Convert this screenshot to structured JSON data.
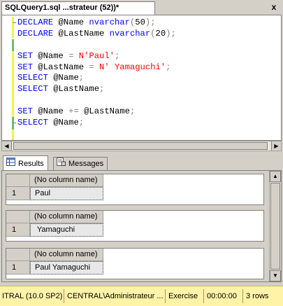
{
  "document_tab": {
    "title": "SQLQuery1.sql ...strateur (52))*",
    "close_label": "x"
  },
  "editor": {
    "lines": [
      {
        "tokens": [
          {
            "t": "DECLARE ",
            "c": "kw"
          },
          {
            "t": "@Name ",
            "c": "plain"
          },
          {
            "t": "nvarchar",
            "c": "kw"
          },
          {
            "t": "(",
            "c": "gr"
          },
          {
            "t": "50",
            "c": "plain"
          },
          {
            "t": ");",
            "c": "gr"
          }
        ]
      },
      {
        "tokens": [
          {
            "t": "DECLARE ",
            "c": "kw"
          },
          {
            "t": "@LastName ",
            "c": "plain"
          },
          {
            "t": "nvarchar",
            "c": "kw"
          },
          {
            "t": "(",
            "c": "gr"
          },
          {
            "t": "20",
            "c": "plain"
          },
          {
            "t": ");",
            "c": "gr"
          }
        ]
      },
      {
        "tokens": []
      },
      {
        "tokens": [
          {
            "t": "SET ",
            "c": "kw"
          },
          {
            "t": "@Name ",
            "c": "plain"
          },
          {
            "t": "= ",
            "c": "gr"
          },
          {
            "t": "N'Paul'",
            "c": "str"
          },
          {
            "t": ";",
            "c": "gr"
          }
        ]
      },
      {
        "tokens": [
          {
            "t": "SET ",
            "c": "kw"
          },
          {
            "t": "@LastName ",
            "c": "plain"
          },
          {
            "t": "= ",
            "c": "gr"
          },
          {
            "t": "N' Yamaguchi'",
            "c": "str"
          },
          {
            "t": ";",
            "c": "gr"
          }
        ]
      },
      {
        "tokens": [
          {
            "t": "SELECT ",
            "c": "kw"
          },
          {
            "t": "@Name",
            "c": "plain"
          },
          {
            "t": ";",
            "c": "gr"
          }
        ]
      },
      {
        "tokens": [
          {
            "t": "SELECT ",
            "c": "kw"
          },
          {
            "t": "@LastName",
            "c": "plain"
          },
          {
            "t": ";",
            "c": "gr"
          }
        ]
      },
      {
        "tokens": []
      },
      {
        "tokens": [
          {
            "t": "SET ",
            "c": "kw"
          },
          {
            "t": "@Name ",
            "c": "plain"
          },
          {
            "t": "+= ",
            "c": "gr"
          },
          {
            "t": "@LastName",
            "c": "plain"
          },
          {
            "t": ";",
            "c": "gr"
          }
        ]
      },
      {
        "tokens": [
          {
            "t": "SELECT ",
            "c": "kw"
          },
          {
            "t": "@Name",
            "c": "plain"
          },
          {
            "t": ";",
            "c": "gr"
          }
        ]
      }
    ]
  },
  "result_tabs": {
    "results_label": "Results",
    "messages_label": "Messages"
  },
  "result_grids": [
    {
      "column_header": "(No column name)",
      "row_number": "1",
      "value": "Paul"
    },
    {
      "column_header": "(No column name)",
      "row_number": "1",
      "value": " Yamaguchi"
    },
    {
      "column_header": "(No column name)",
      "row_number": "1",
      "value": "Paul Yamaguchi"
    }
  ],
  "status_bar": {
    "server": "ITRAL (10.0 SP2)",
    "user": "CENTRAL\\Administrateur ...",
    "database": "Exercise",
    "elapsed": "00:00:00",
    "rows": "3 rows"
  },
  "colors": {
    "keyword": "#0000ff",
    "string": "#ff0000",
    "operator": "#808080",
    "status_bar": "#fff3a8",
    "changed_line_marker": "#f2f24a",
    "saved_line_marker": "#6ebf6e"
  }
}
